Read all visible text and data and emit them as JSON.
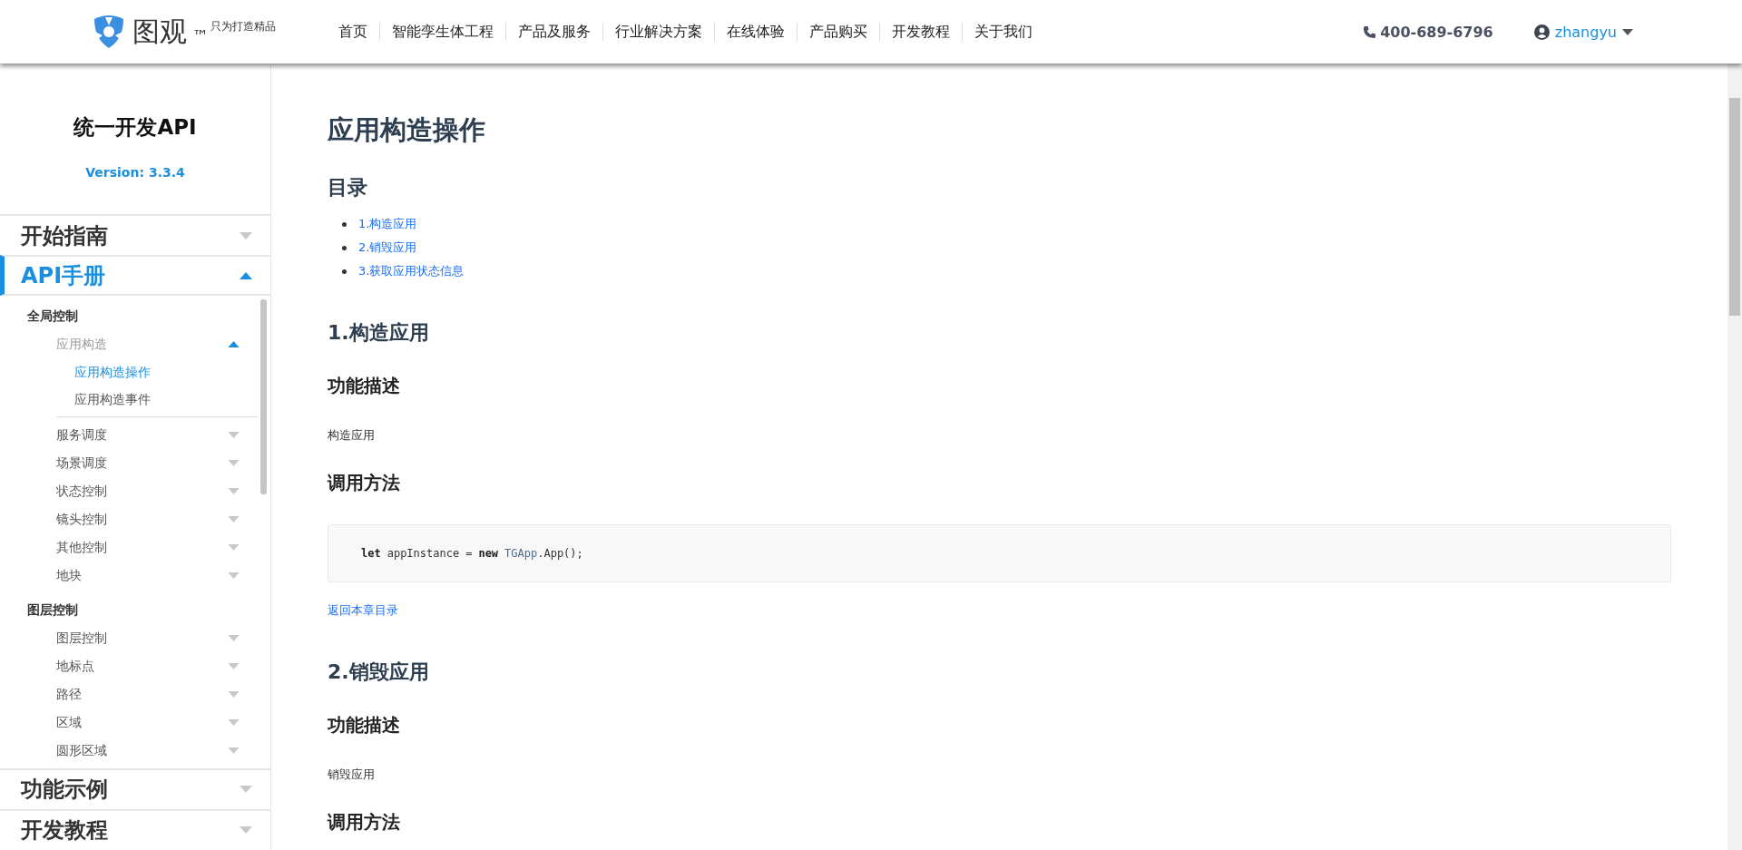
{
  "header": {
    "brand": "图观",
    "trademark": "™",
    "slogan": "只为打造精品",
    "nav": [
      {
        "label": "首页"
      },
      {
        "label": "智能孪生体工程"
      },
      {
        "label": "产品及服务"
      },
      {
        "label": "行业解决方案"
      },
      {
        "label": "在线体验"
      },
      {
        "label": "产品购买"
      },
      {
        "label": "开发教程"
      },
      {
        "label": "关于我们"
      }
    ],
    "phone": "400-689-6796",
    "user": "zhangyu"
  },
  "sidebar": {
    "title": "统一开发API",
    "version": "Version: 3.3.4",
    "sections": [
      {
        "label": "开始指南",
        "expanded": false
      },
      {
        "label": "API手册",
        "expanded": true,
        "children": [
          {
            "kind": "group",
            "label": "全局控制",
            "children": [
              {
                "kind": "item",
                "label": "应用构造",
                "expanded": true,
                "children": [
                  {
                    "kind": "leaf",
                    "label": "应用构造操作",
                    "selected": true
                  },
                  {
                    "kind": "leaf",
                    "label": "应用构造事件",
                    "selected": false
                  }
                ]
              },
              {
                "kind": "item",
                "label": "服务调度",
                "expanded": false
              },
              {
                "kind": "item",
                "label": "场景调度",
                "expanded": false
              },
              {
                "kind": "item",
                "label": "状态控制",
                "expanded": false
              },
              {
                "kind": "item",
                "label": "镜头控制",
                "expanded": false
              },
              {
                "kind": "item",
                "label": "其他控制",
                "expanded": false
              },
              {
                "kind": "item",
                "label": "地块",
                "expanded": false
              }
            ]
          },
          {
            "kind": "group",
            "label": "图层控制",
            "children": [
              {
                "kind": "item",
                "label": "图层控制",
                "expanded": false
              },
              {
                "kind": "item",
                "label": "地标点",
                "expanded": false
              },
              {
                "kind": "item",
                "label": "路径",
                "expanded": false
              },
              {
                "kind": "item",
                "label": "区域",
                "expanded": false
              },
              {
                "kind": "item",
                "label": "圆形区域",
                "expanded": false
              }
            ]
          }
        ]
      },
      {
        "label": "功能示例",
        "expanded": false
      },
      {
        "label": "开发教程",
        "expanded": false
      }
    ]
  },
  "content": {
    "blocks": [
      {
        "kind": "title",
        "text": "应用构造操作"
      },
      {
        "kind": "h2",
        "text": "目录"
      },
      {
        "kind": "toc",
        "items": [
          "1.构造应用",
          "2.销毁应用",
          "3.获取应用状态信息"
        ]
      },
      {
        "kind": "h2",
        "text": "1.构造应用"
      },
      {
        "kind": "h3",
        "text": "功能描述"
      },
      {
        "kind": "p",
        "text": "构造应用"
      },
      {
        "kind": "h3",
        "text": "调用方法"
      },
      {
        "kind": "code",
        "tokens": [
          {
            "kind": "keyword",
            "text": "let"
          },
          {
            "kind": "plain",
            "text": "appInstance"
          },
          {
            "kind": "plain",
            "text": "="
          },
          {
            "kind": "keyword",
            "text": "new"
          },
          {
            "kind": "class",
            "text": "TGApp"
          },
          {
            "kind": "plain",
            "text": ".App();"
          }
        ]
      },
      {
        "kind": "link",
        "text": "返回本章目录"
      },
      {
        "kind": "h2",
        "text": "2.销毁应用"
      },
      {
        "kind": "h3",
        "text": "功能描述"
      },
      {
        "kind": "p",
        "text": "销毁应用"
      },
      {
        "kind": "h3",
        "text": "调用方法"
      }
    ]
  }
}
